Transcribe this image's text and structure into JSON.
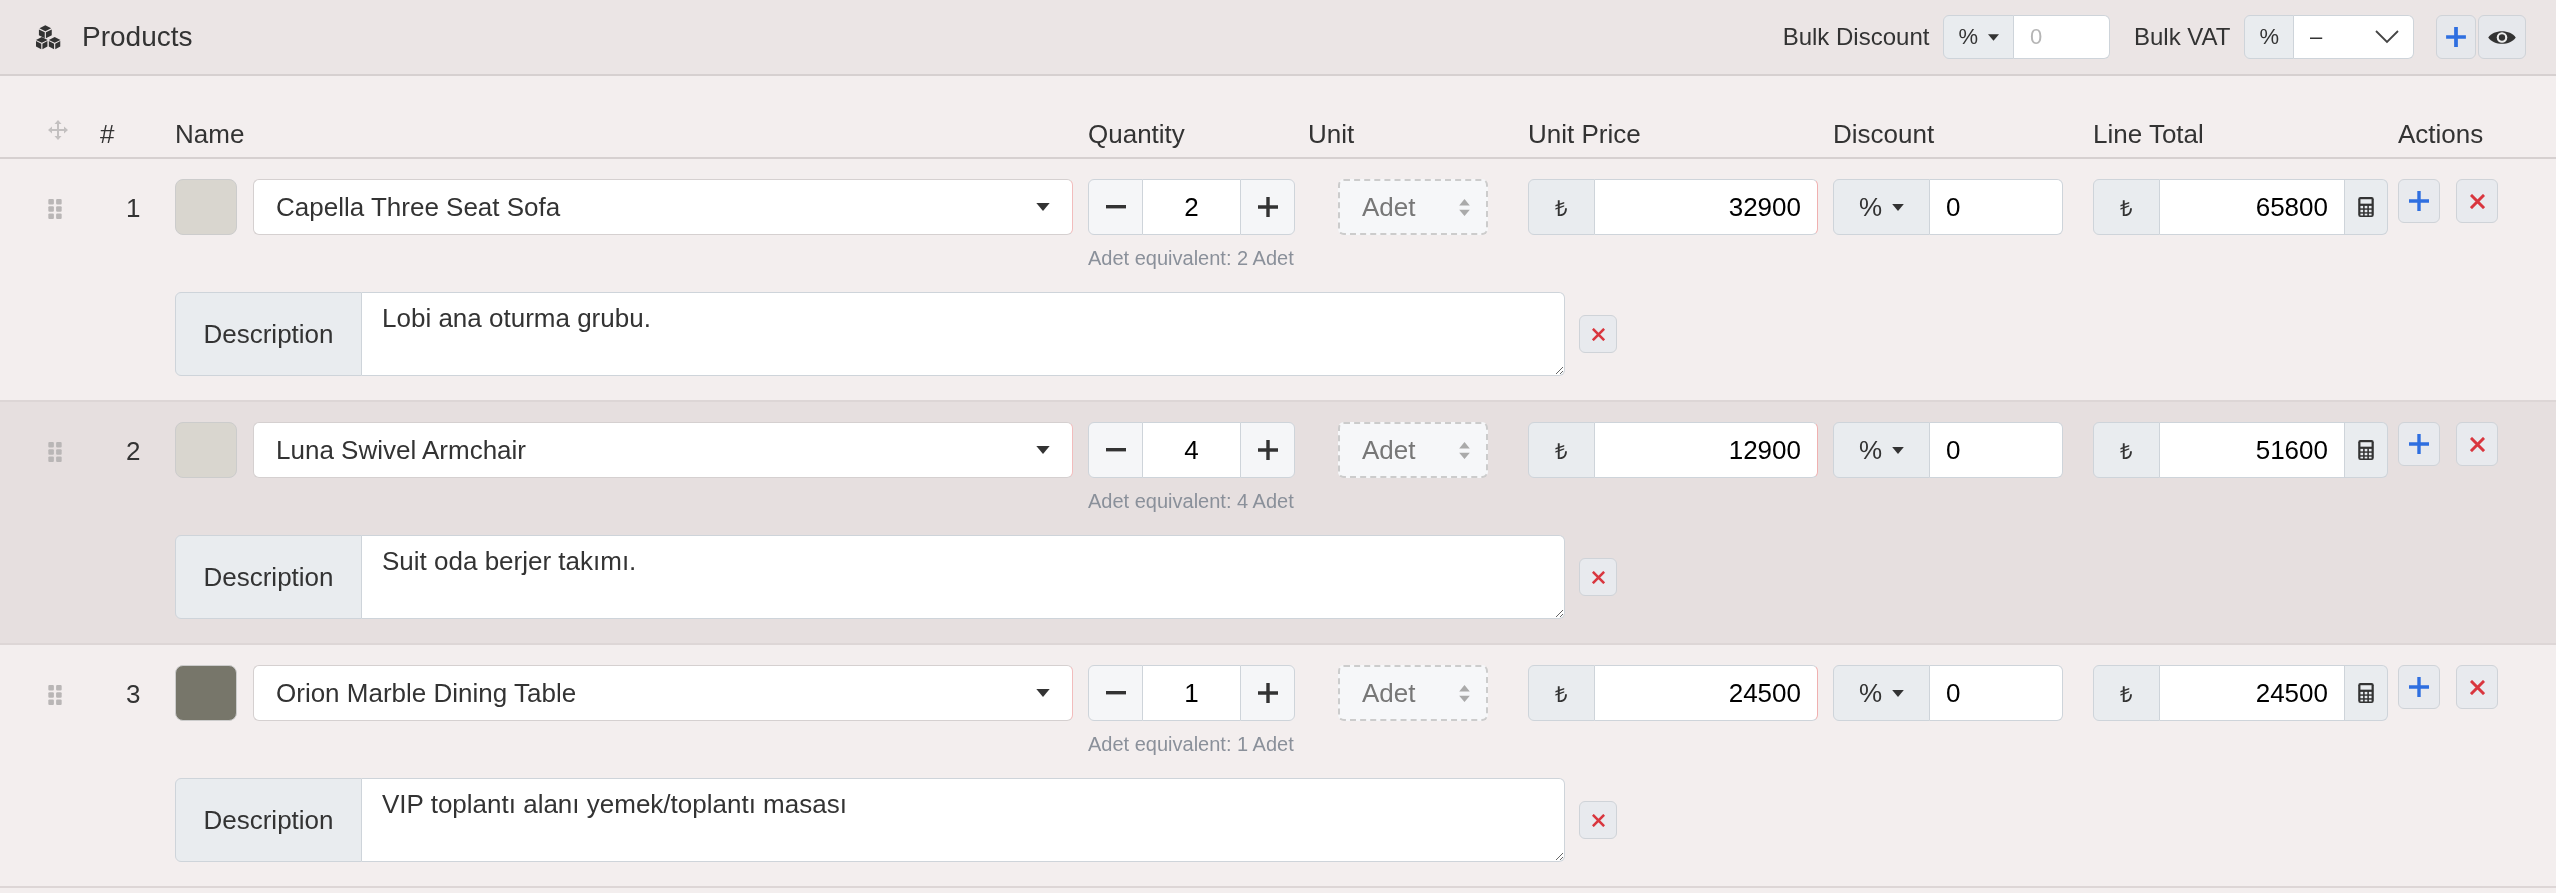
{
  "header": {
    "title": "Products",
    "bulk_discount": {
      "label": "Bulk Discount",
      "type": "%",
      "placeholder": "0"
    },
    "bulk_vat": {
      "label": "Bulk VAT",
      "type": "%",
      "value": "–"
    }
  },
  "columns": [
    "#",
    "Name",
    "Quantity",
    "Unit",
    "Unit Price",
    "Discount",
    "Line Total",
    "Actions"
  ],
  "rows": [
    {
      "number": "1",
      "product": "Capella Three Seat Sofa",
      "quantity": "2",
      "unit": "Adet",
      "equivalent": "Adet equivalent: 2 Adet",
      "currency": "₺",
      "unit_price": "32900",
      "discount_type": "%",
      "discount": "0",
      "line_currency": "₺",
      "line_total": "65800",
      "description_label": "Description",
      "description": "Lobi ana oturma grubu.",
      "highlighted": false
    },
    {
      "number": "2",
      "product": "Luna Swivel Armchair",
      "quantity": "4",
      "unit": "Adet",
      "equivalent": "Adet equivalent: 4 Adet",
      "currency": "₺",
      "unit_price": "12900",
      "discount_type": "%",
      "discount": "0",
      "line_currency": "₺",
      "line_total": "51600",
      "description_label": "Description",
      "description": "Suit oda berjer takımı.",
      "highlighted": true
    },
    {
      "number": "3",
      "product": "Orion Marble Dining Table",
      "quantity": "1",
      "unit": "Adet",
      "equivalent": "Adet equivalent: 1 Adet",
      "currency": "₺",
      "unit_price": "24500",
      "discount_type": "%",
      "discount": "0",
      "line_currency": "₺",
      "line_total": "24500",
      "description_label": "Description",
      "description": "VIP toplantı alanı yemek/toplantı masası",
      "highlighted": false
    }
  ]
}
